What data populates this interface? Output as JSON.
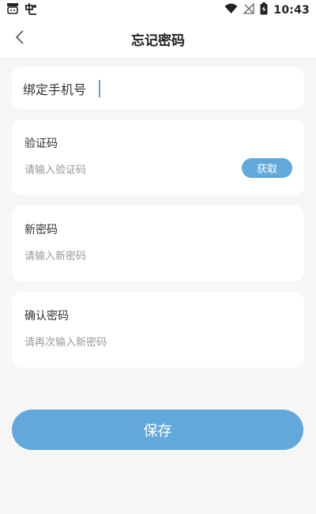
{
  "status_bar": {
    "time": "10:43",
    "left_icons": [
      "notification-face-icon",
      "app-logo-icon"
    ],
    "right_icons": [
      "wifi-icon",
      "no-signal-icon",
      "battery-charging-icon"
    ]
  },
  "nav": {
    "title": "忘记密码",
    "back_icon": "chevron-left-icon"
  },
  "phone": {
    "label": "绑定手机号"
  },
  "verify": {
    "label": "验证码",
    "placeholder": "请输入验证码",
    "button": "获取"
  },
  "new_password": {
    "label": "新密码",
    "placeholder": "请输入新密码"
  },
  "confirm_password": {
    "label": "确认密码",
    "placeholder": "请再次输入新密码"
  },
  "save": {
    "label": "保存"
  },
  "colors": {
    "accent": "#62a9db",
    "background": "#f6f6f6",
    "card": "#ffffff"
  }
}
